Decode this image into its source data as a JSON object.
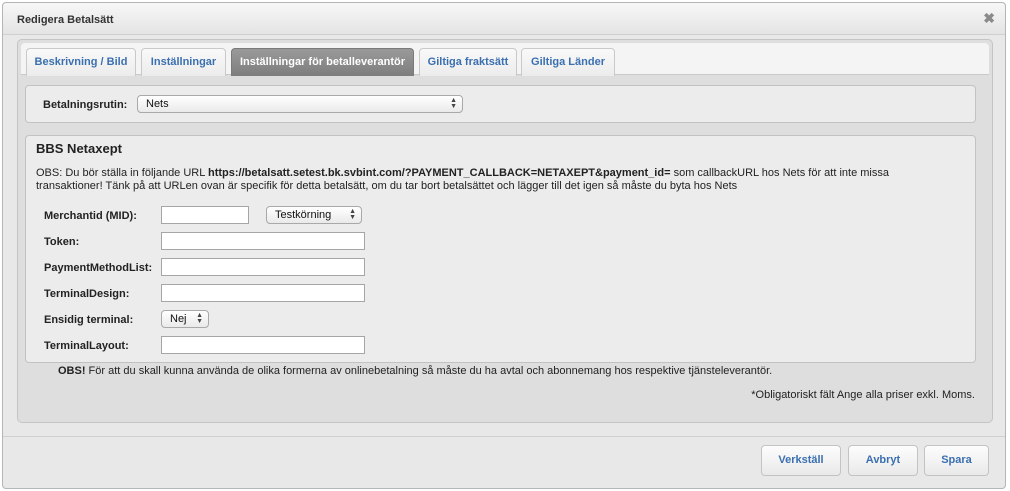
{
  "dialog": {
    "title": "Redigera Betalsätt",
    "close_icon": "close-icon"
  },
  "tabs": [
    {
      "label": "Beskrivning / Bild",
      "active": false
    },
    {
      "label": "Inställningar",
      "active": false
    },
    {
      "label": "Inställningar för betalleverantör",
      "active": true
    },
    {
      "label": "Giltiga fraktsätt",
      "active": false
    },
    {
      "label": "Giltiga Länder",
      "active": false
    }
  ],
  "routine": {
    "label": "Betalningsrutin:",
    "selected": "Nets"
  },
  "section": {
    "title": "BBS Netaxept",
    "obs_prefix": "OBS: Du bör ställa in följande URL ",
    "obs_url": "https://betalsatt.setest.bk.svbint.com/?PAYMENT_CALLBACK=NETAXEPT&payment_id=",
    "obs_suffix": " som callbackURL hos Nets för att inte missa transaktioner! Tänk på att URLen ovan är specifik för detta betalsätt, om du tar bort betalsättet och lägger till det igen så måste du byta hos Nets",
    "fields": {
      "merchant_label": "Merchantid (MID):",
      "merchant_value": "",
      "mode_selected": "Testkörning",
      "token_label": "Token:",
      "token_value": "",
      "pml_label": "PaymentMethodList:",
      "pml_value": "",
      "design_label": "TerminalDesign:",
      "design_value": "",
      "singlepage_label": "Ensidig terminal:",
      "singlepage_selected": "Nej",
      "layout_label": "TerminalLayout:",
      "layout_value": ""
    }
  },
  "notes": {
    "obs_bold": "OBS!",
    "obs_text": " För att du skall kunna använda de olika formerna av onlinebetalning så måste du ha avtal och abonnemang hos respektive tjänsteleverantör.",
    "mandatory": "*Obligatoriskt fält Ange alla priser exkl. Moms."
  },
  "buttons": {
    "apply": "Verkställ",
    "cancel": "Avbryt",
    "save": "Spara"
  }
}
